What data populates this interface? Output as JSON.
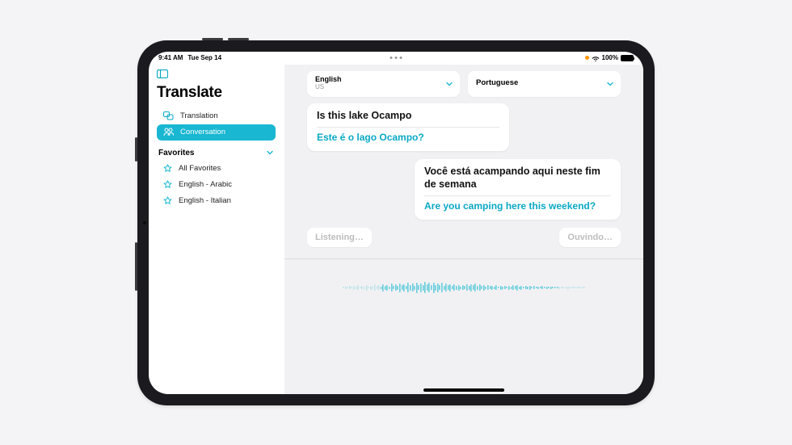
{
  "status": {
    "time": "9:41 AM",
    "date": "Tue Sep 14",
    "battery_pct": "100%"
  },
  "sidebar": {
    "title": "Translate",
    "items": [
      {
        "label": "Translation",
        "active": false
      },
      {
        "label": "Conversation",
        "active": true
      }
    ],
    "favorites_header": "Favorites",
    "favorites": [
      {
        "label": "All Favorites"
      },
      {
        "label": "English - Arabic"
      },
      {
        "label": "English - Italian"
      }
    ]
  },
  "languages": {
    "left": {
      "name": "English",
      "subtitle": "US"
    },
    "right": {
      "name": "Portuguese"
    }
  },
  "conversation": {
    "left": {
      "source": "Is this lake Ocampo",
      "translation": "Este é o lago Ocampo?"
    },
    "right": {
      "source": "Você está acampando aqui neste fim de semana",
      "translation": "Are you camping here this weekend?"
    }
  },
  "listening": {
    "left": "Listening…",
    "right": "Ouvindo…"
  },
  "colors": {
    "accent": "#19b7d1",
    "accent_text": "#0aa8c4"
  }
}
